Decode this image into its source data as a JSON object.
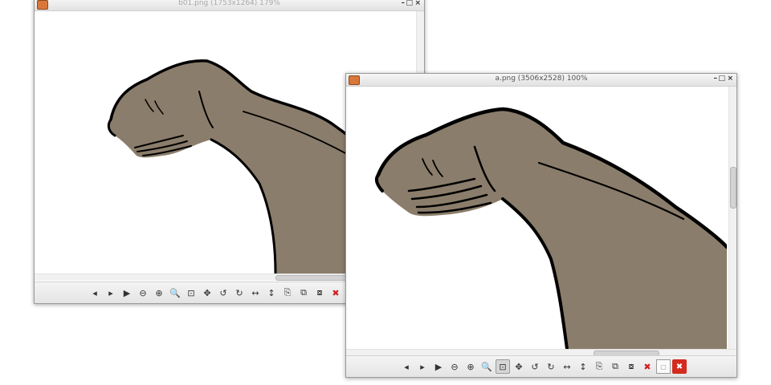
{
  "windows": [
    {
      "title": "b01.png (1753x1264) 179%",
      "controls": {
        "minimize": "–",
        "maximize": "□",
        "close": "×"
      }
    },
    {
      "title": "a.png (3506x2528) 100%",
      "controls": {
        "minimize": "–",
        "maximize": "□",
        "close": "×"
      }
    }
  ],
  "colors": {
    "skin": "#8b7d6b",
    "outline": "#000000",
    "canvas": "#ffffff"
  },
  "icons": {
    "prev": "◂",
    "next": "▸",
    "play": "▶",
    "zoom_out": "⊖",
    "zoom_in": "⊕",
    "zoom_orig": "🔍",
    "zoom_fit": "⊡",
    "pan": "✥",
    "rotate_ccw": "↺",
    "rotate_cw": "↻",
    "flip_h": "↔",
    "flip_v": "↕",
    "copy": "⎘",
    "move": "⧉",
    "rename": "⧇",
    "delete": "✖",
    "properties": "▢",
    "quit": "✖"
  }
}
